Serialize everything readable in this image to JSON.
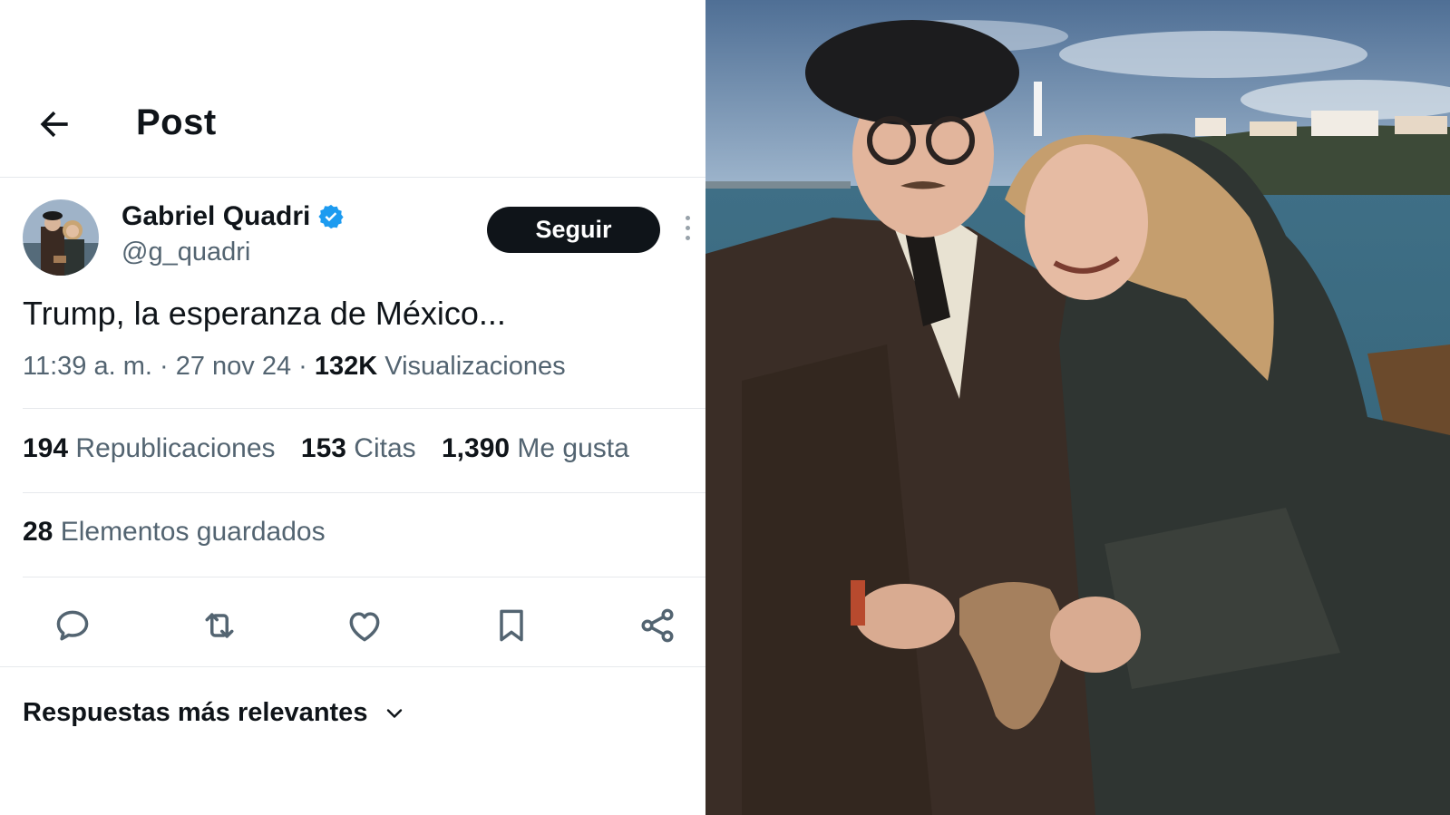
{
  "header": {
    "title": "Post"
  },
  "author": {
    "name": "Gabriel Quadri",
    "handle": "@g_quadri",
    "verified": true
  },
  "follow_label": "Seguir",
  "tweet": {
    "text": "Trump, la esperanza de México..."
  },
  "meta": {
    "time": "11:39 a. m.",
    "sep1": " · ",
    "date": "27 nov 24",
    "sep2": " · ",
    "views": "132K",
    "views_label": " Visualizaciones"
  },
  "stats": {
    "reposts": "194",
    "reposts_label": " Republicaciones",
    "quotes": "153",
    "quotes_label": " Citas",
    "likes": "1,390",
    "likes_label": " Me gusta",
    "bookmarks": "28",
    "bookmarks_label": " Elementos guardados"
  },
  "actions": [
    "reply-icon",
    "repost-icon",
    "like-icon",
    "bookmark-icon",
    "share-icon"
  ],
  "replies_sort": "Respuestas más relevantes",
  "colors": {
    "text": "#0f1419",
    "secondary": "#536471",
    "verified": "#1d9bf0",
    "follow_bg": "#0f1419"
  }
}
